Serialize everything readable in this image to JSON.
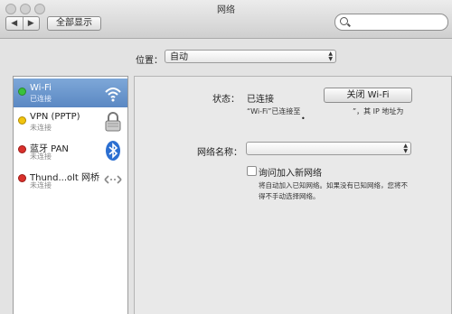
{
  "window": {
    "title": "网络"
  },
  "toolbar": {
    "back": "◀",
    "forward": "▶",
    "show_all": "全部显示",
    "search_placeholder": ""
  },
  "location": {
    "label": "位置：",
    "value": "自动"
  },
  "services": [
    {
      "name": "Wi-Fi",
      "status": "已连接",
      "dot": "green",
      "icon": "wifi-icon"
    },
    {
      "name": "VPN (PPTP)",
      "status": "未连接",
      "dot": "yellow",
      "icon": "lock-icon"
    },
    {
      "name": "蓝牙 PAN",
      "status": "未连接",
      "dot": "red",
      "icon": "bluetooth-icon"
    },
    {
      "name": "Thund...olt 网桥",
      "status": "未连接",
      "dot": "red",
      "icon": "thunderbolt-bridge-icon"
    }
  ],
  "detail": {
    "status_label": "状态：",
    "status_value": "已连接",
    "toggle_wifi": "关闭 Wi-Fi",
    "conn_desc": "“Wi-Fi”已连接至",
    "conn_desc2": "”，其 IP 地址为",
    "bullet": "•",
    "network_name_label": "网络名称：",
    "ask_join_label": "询问加入新网络",
    "ask_join_help": "将自动加入已知网络。如果没有已知网络，您将不得不手动选择网络。"
  }
}
